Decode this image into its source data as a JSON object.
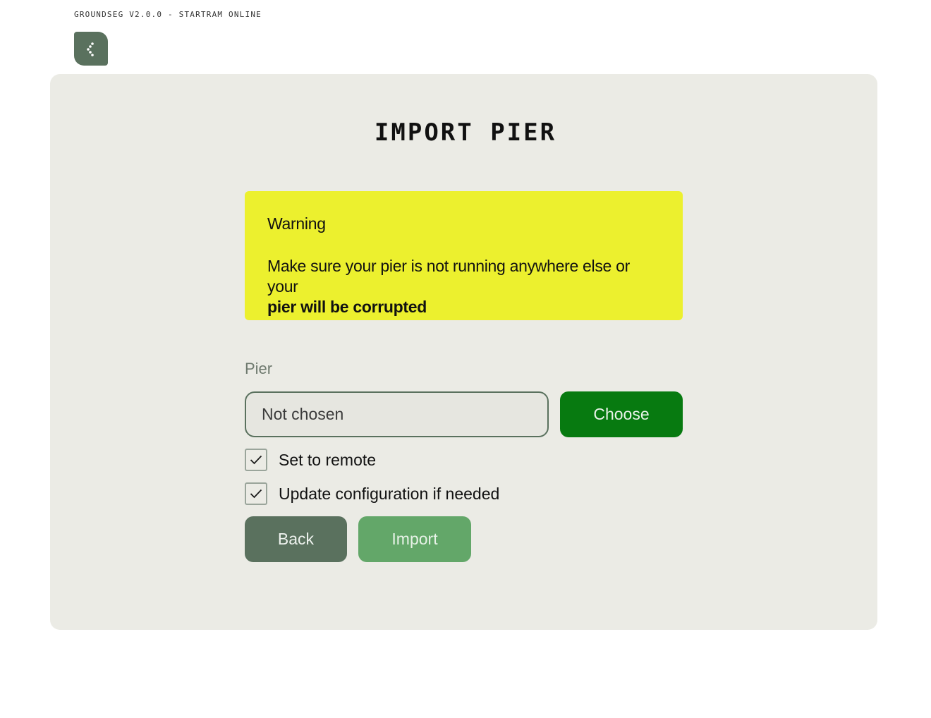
{
  "header": {
    "version_text": "GROUNDSEG V2.0.0 - STARTRAM ONLINE",
    "logo_icon": "groundseg-logo-icon"
  },
  "page": {
    "title": "IMPORT PIER"
  },
  "warning": {
    "heading": "Warning",
    "message": "Make sure your pier is not running anywhere else or your",
    "message_bold": "pier will be corrupted",
    "color": "#ecf02e"
  },
  "pier_field": {
    "label": "Pier",
    "value": "Not chosen",
    "choose_label": "Choose"
  },
  "options": [
    {
      "label": "Set to remote",
      "checked": true
    },
    {
      "label": "Update configuration if needed",
      "checked": true
    }
  ],
  "actions": {
    "back_label": "Back",
    "import_label": "Import"
  },
  "colors": {
    "accent": "#5a715e",
    "choose": "#077a10",
    "import": "#63a769",
    "card": "#ebebe5"
  }
}
